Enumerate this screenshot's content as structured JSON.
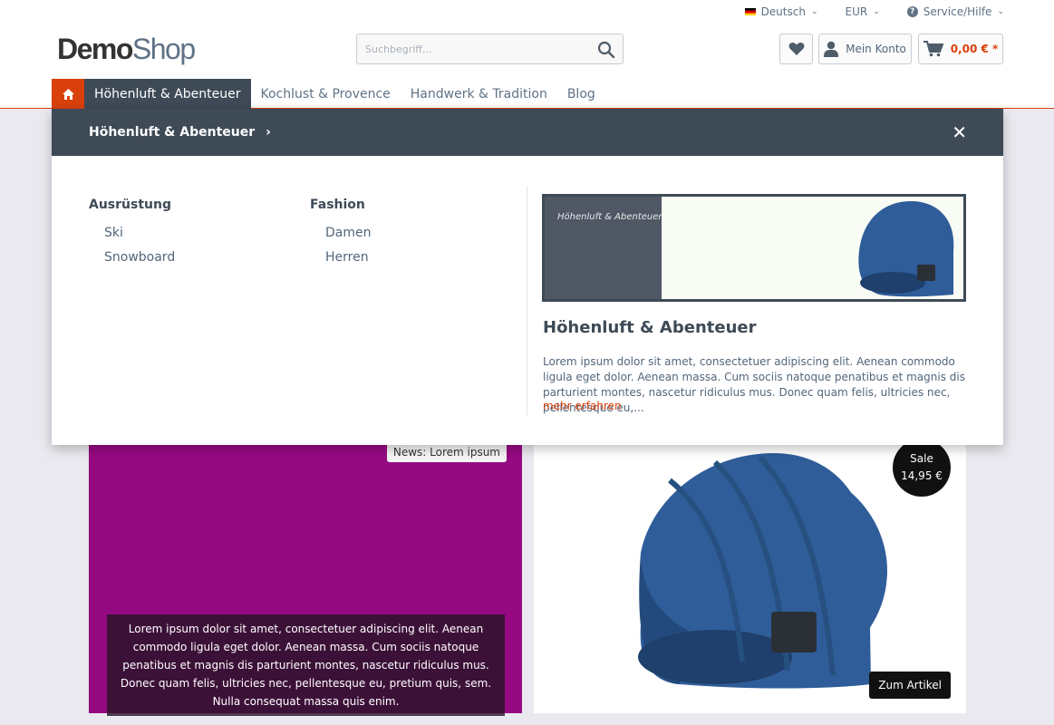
{
  "topbar": {
    "language": "Deutsch",
    "currency": "EUR",
    "service": "Service/Hilfe"
  },
  "logo": {
    "bold": "Demo",
    "light": "Shop"
  },
  "search": {
    "placeholder": "Suchbegriff..."
  },
  "header": {
    "account_label": "Mein Konto",
    "cart_total": "0,00 € *"
  },
  "nav": {
    "tabs": [
      {
        "label": "Höhenluft & Abenteuer"
      },
      {
        "label": "Kochlust & Provence"
      },
      {
        "label": "Handwerk & Tradition"
      },
      {
        "label": "Blog"
      }
    ]
  },
  "mega": {
    "title": "Höhenluft & Abenteuer",
    "columns": [
      {
        "heading": "Ausrüstung",
        "items": [
          "Ski",
          "Snowboard"
        ]
      },
      {
        "heading": "Fashion",
        "items": [
          "Damen",
          "Herren"
        ]
      }
    ],
    "teaser_label": "Höhenluft & Abenteuer",
    "heading": "Höhenluft & Abenteuer",
    "description": "Lorem ipsum dolor sit amet, consectetuer adipiscing elit. Aenean commodo ligula eget dolor. Aenean massa. Cum sociis natoque penatibus et magnis dis parturient montes, nascetur ridiculus mus. Donec quam felis, ultricies nec, pellentesque eu,...",
    "more_link": "mehr erfahren"
  },
  "promo": {
    "badge": "News: Lorem ipsum",
    "text": "Lorem ipsum dolor sit amet, consectetuer adipiscing elit. Aenean commodo ligula eget dolor. Aenean massa. Cum sociis natoque penatibus et magnis dis parturient montes, nascetur ridiculus mus. Donec quam felis, ultricies nec, pellentesque eu, pretium quis, sem. Nulla consequat massa quis enim."
  },
  "product": {
    "sale_label": "Sale",
    "price": "14,95 €",
    "cta": "Zum Artikel"
  },
  "colors": {
    "accent": "#d9400b",
    "nav_dark": "#3e4a56",
    "promo": "#960a81",
    "beanie": "#2f5d99"
  }
}
